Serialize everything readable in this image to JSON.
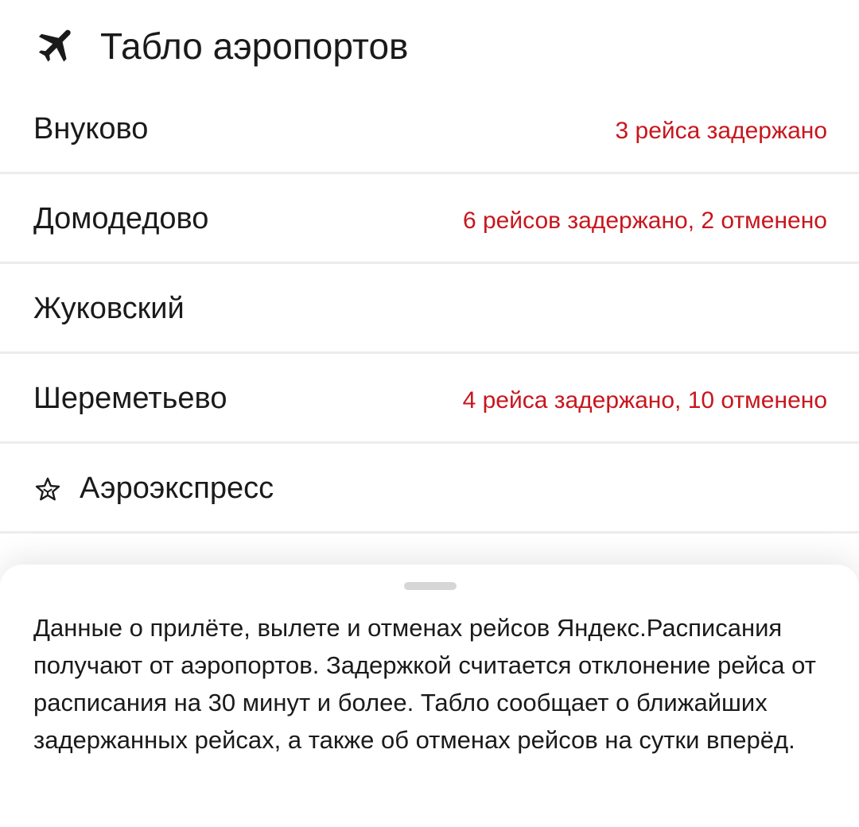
{
  "header": {
    "title": "Табло аэропортов",
    "icon": "airplane-icon"
  },
  "airports": [
    {
      "name": "Внуково",
      "status": "3 рейса задержано"
    },
    {
      "name": "Домодедово",
      "status": "6 рейсов задержано, 2 отменено"
    },
    {
      "name": "Жуковский",
      "status": ""
    },
    {
      "name": "Шереметьево",
      "status": "4 рейса задержано, 10 отменено"
    }
  ],
  "aeroexpress": {
    "name": "Аэроэкспресс",
    "icon": "aeroexpress-star-icon"
  },
  "info_sheet": {
    "text": "Данные о прилёте, вылете и отменах рейсов Яндекс.Расписания получают от аэропортов. Задержкой считается отклонение рейса от расписания на 30 минут и более. Табло сообщает о ближайших задержанных рейсах, а также об отменах рейсов на сутки вперёд."
  },
  "colors": {
    "status_red": "#c8161d",
    "text": "#1a1a1a",
    "divider": "#ececec"
  }
}
